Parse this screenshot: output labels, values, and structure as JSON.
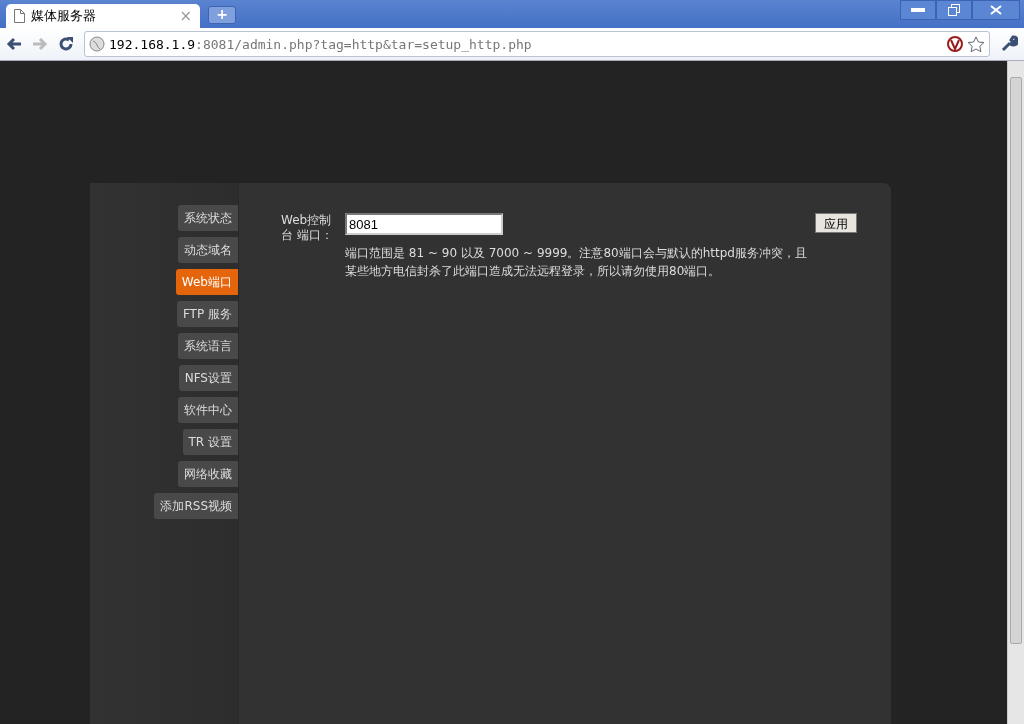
{
  "browser": {
    "tab": {
      "title": "媒体服务器",
      "close": "×"
    },
    "new_tab": "+",
    "address": {
      "host": "192.168.1.9",
      "path": ":8081/admin.php?tag=http&tar=setup_http.php"
    }
  },
  "sidebar": {
    "items": [
      {
        "label": "系统状态",
        "selected": false
      },
      {
        "label": "动态域名",
        "selected": false
      },
      {
        "label": "Web端口",
        "selected": true
      },
      {
        "label": "FTP 服务",
        "selected": false
      },
      {
        "label": "系统语言",
        "selected": false
      },
      {
        "label": "NFS设置",
        "selected": false
      },
      {
        "label": "软件中心",
        "selected": false
      },
      {
        "label": "TR 设置",
        "selected": false
      },
      {
        "label": "网络收藏",
        "selected": false
      },
      {
        "label": "添加RSS视频",
        "selected": false
      }
    ]
  },
  "form": {
    "label": "Web控制台 端口：",
    "port": "8081",
    "help": "端口范围是 81 ~ 90 以及 7000 ~ 9999。注意80端口会与默认的httpd服务冲突，且某些地方电信封杀了此端口造成无法远程登录，所以请勿使用80端口。",
    "apply": "应用"
  }
}
